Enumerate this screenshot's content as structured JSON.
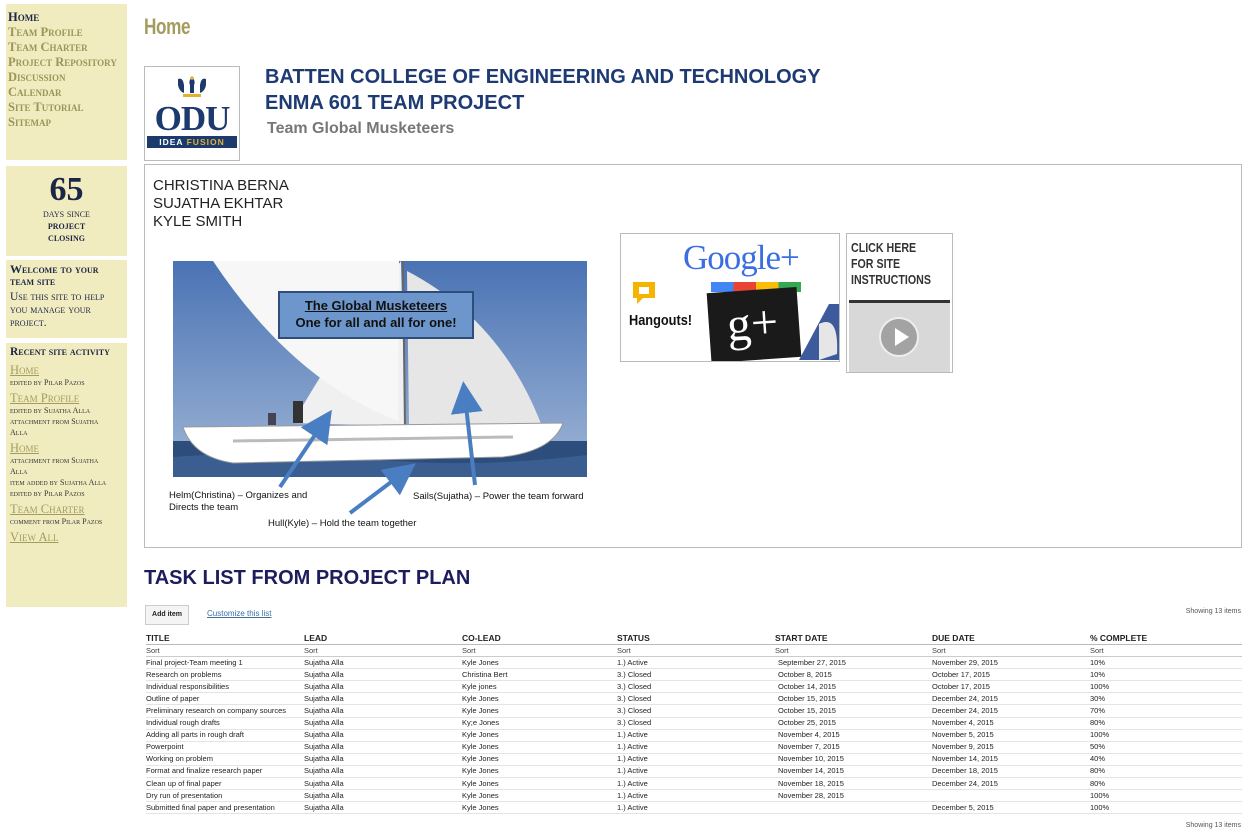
{
  "nav": [
    "Home",
    "Team Profile",
    "Team Charter",
    "Project Repository",
    "Discussion",
    "Calendar",
    "Site Tutorial",
    "Sitemap"
  ],
  "counter": {
    "number": "65",
    "line1": "days since",
    "line2": "project",
    "line3": "closing"
  },
  "welcome": {
    "heading": "Welcome to your team site",
    "text": "Use this site to help you manage your project."
  },
  "recent": {
    "heading": "Recent site activity",
    "items": [
      {
        "link": "Home",
        "subs": [
          "edited by Pilar Pazos"
        ]
      },
      {
        "link": "Team Profile",
        "subs": [
          "edited by Sujatha Alla",
          "attachment from Sujatha",
          "Alla"
        ]
      },
      {
        "link": "Home",
        "subs": [
          "attachment from Sujatha",
          "Alla",
          "item added by Sujatha Alla",
          "edited by Pilar Pazos"
        ]
      },
      {
        "link": "Team Charter",
        "subs": [
          "comment from Pilar Pazos"
        ]
      }
    ],
    "view_all": "View All"
  },
  "page_title": "Home",
  "logo": {
    "text": "ODU",
    "tagline_a": "IDEA ",
    "tagline_b": "FUSION"
  },
  "header": {
    "college": "BATTEN COLLEGE OF ENGINEERING AND TECHNOLOGY",
    "course": "ENMA 601 TEAM PROJECT",
    "team": "Team Global Musketeers"
  },
  "members": [
    "CHRISTINA BERNA",
    "SUJATHA EKHTAR",
    "KYLE SMITH"
  ],
  "photo": {
    "banner_title": "The Global Musketeers",
    "banner_motto": "One for all and all for one!",
    "helm": "Helm(Christina) – Organizes and Directs the team",
    "hull": "Hull(Kyle) – Hold the team together",
    "sails": "Sails(Sujatha) – Power the team forward"
  },
  "gplus": {
    "google": "Google+",
    "hangouts": "Hangouts!",
    "gplus": "g+"
  },
  "tutorial": {
    "line1": "CLICK HERE",
    "line2": "FOR SITE",
    "line3": "INSTRUCTIONS"
  },
  "tasks": {
    "title": "TASK LIST FROM PROJECT PLAN",
    "add_item": "Add item",
    "customize": "Customize this list",
    "showing": "Showing 13 items",
    "columns": [
      "TITLE",
      "LEAD",
      "CO-LEAD",
      "STATUS",
      "START DATE",
      "DUE DATE",
      "% COMPLETE"
    ],
    "sort_label": "Sort",
    "rows": [
      [
        "Final project-Team meeting 1",
        "Sujatha Alla",
        "Kyle Jones",
        "1.) Active",
        "September 27, 2015",
        "November 29, 2015",
        "10%"
      ],
      [
        "Research on problems",
        "Sujatha Alla",
        "Christina Bert",
        "3.) Closed",
        "October 8, 2015",
        "October 17, 2015",
        "10%"
      ],
      [
        "Individual responsibilities",
        "Sujatha Alla",
        "Kyle jones",
        "3.) Closed",
        "October 14, 2015",
        "October 17, 2015",
        "100%"
      ],
      [
        "Outline of paper",
        "Sujatha Alla",
        "Kyle Jones",
        "3.) Closed",
        "October 15, 2015",
        "December 24, 2015",
        "30%"
      ],
      [
        "Preliminary research on company sources",
        "Sujatha Alla",
        "Kyle Jones",
        "3.) Closed",
        "October 15, 2015",
        "December 24, 2015",
        "70%"
      ],
      [
        "Individual rough drafts",
        "Sujatha Alla",
        "Ky;e Jones",
        "3.) Closed",
        "October 25, 2015",
        "November 4, 2015",
        "80%"
      ],
      [
        "Adding all parts in rough draft",
        "Sujatha Alla",
        "Kyle Jones",
        "1.) Active",
        "November 4, 2015",
        "November 5, 2015",
        "100%"
      ],
      [
        "Powerpoint",
        "Sujatha Alla",
        "Kyle Jones",
        "1.) Active",
        "November 7, 2015",
        "November 9, 2015",
        "50%"
      ],
      [
        "Working on problem",
        "Sujatha Alla",
        "Kyle Jones",
        "1.) Active",
        "November 10, 2015",
        "November 14, 2015",
        "40%"
      ],
      [
        "Format and finalize research paper",
        "Sujatha Alla",
        "Kyle Jones",
        "1.) Active",
        "November 14, 2015",
        "December 18, 2015",
        "80%"
      ],
      [
        "Clean up of final paper",
        "Sujatha Alla",
        "Kyle Jones",
        "1.) Active",
        "November 18, 2015",
        "December 24, 2015",
        "80%"
      ],
      [
        "Dry run of presentation",
        "Sujatha Alla",
        "Kyle Jones",
        "1.) Active",
        "November 28, 2015",
        "",
        "100%"
      ],
      [
        "Submitted final paper and presentation",
        "Sujatha Alla",
        "Kyle Jones",
        "1.) Active",
        "",
        "December 5, 2015",
        "100%"
      ]
    ]
  }
}
